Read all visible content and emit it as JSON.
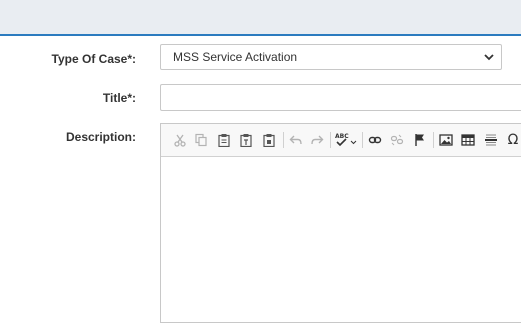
{
  "form": {
    "type_of_case": {
      "label": "Type Of Case*:",
      "value": "MSS Service Activation"
    },
    "title": {
      "label": "Title*:",
      "value": ""
    },
    "description": {
      "label": "Description:",
      "toolbar_icons": [
        "cut-icon",
        "copy-icon",
        "paste-icon",
        "paste-text-icon",
        "paste-word-icon",
        "undo-icon",
        "redo-icon",
        "spellcheck-icon",
        "link-icon",
        "unlink-icon",
        "anchor-flag-icon",
        "image-icon",
        "table-icon",
        "horizontal-line-icon",
        "special-character-icon"
      ],
      "spellcheck_glyph": "ABC",
      "special_char_glyph": "Ω"
    }
  },
  "colors": {
    "topbar_bg": "#e9edf2",
    "topbar_border": "#2b7bbf",
    "label_text": "#333333"
  }
}
